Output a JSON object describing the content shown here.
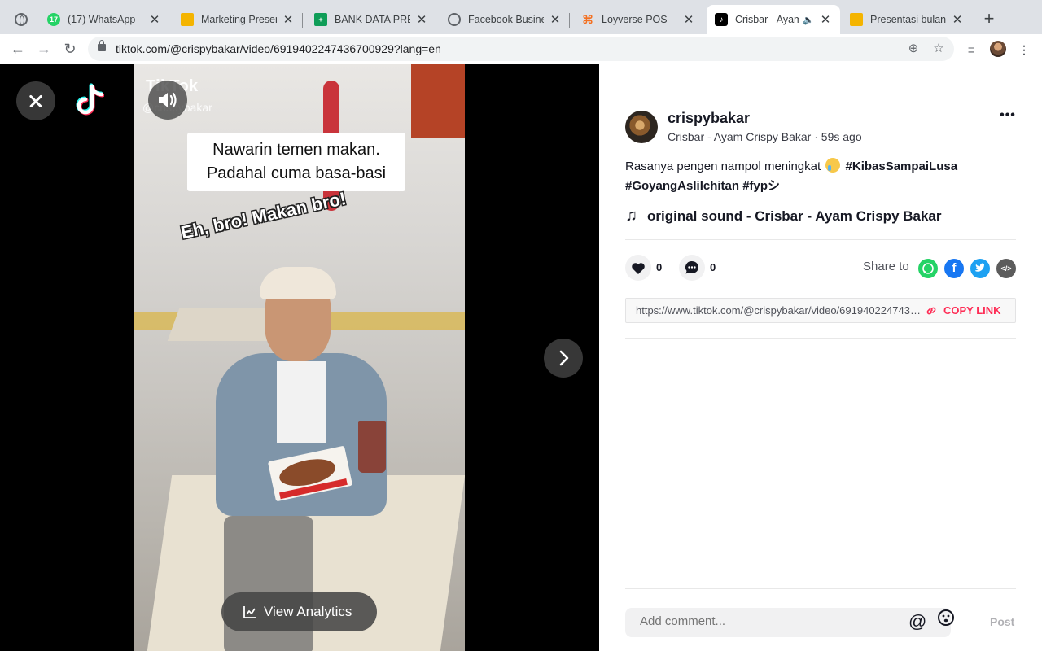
{
  "browser": {
    "tabs": [
      {
        "title": "(17) WhatsApp",
        "favicon_color": "#25d366",
        "favicon_text": "17"
      },
      {
        "title": "Marketing Presen",
        "favicon_color": "#f4b400",
        "favicon_text": ""
      },
      {
        "title": "BANK DATA PRES",
        "favicon_color": "#0f9d58",
        "favicon_text": ""
      },
      {
        "title": "Facebook Busine",
        "favicon_color": "#5f6368",
        "favicon_text": ""
      },
      {
        "title": "Loyverse POS",
        "favicon_color": "#f37021",
        "favicon_text": ""
      },
      {
        "title": "Crisbar - Ayam",
        "favicon_color": "#000000",
        "favicon_text": ""
      },
      {
        "title": "Presentasi bulan",
        "favicon_color": "#f4b400",
        "favicon_text": ""
      }
    ],
    "active_tab_index": 5,
    "url": "tiktok.com/@crispybakar/video/6919402247436700929?lang=en"
  },
  "video": {
    "watermark_logo": "TikTok",
    "watermark_user": "@crispybakar",
    "caption_line1": "Nawarin temen makan.",
    "caption_line2": "Padahal cuma basa-basi",
    "sticker_text": "Eh, bro! Makan bro!",
    "analytics_label": "View Analytics"
  },
  "post": {
    "username": "crispybakar",
    "display_name": "Crisbar - Ayam Crispy Bakar",
    "time_ago": "59s ago",
    "description_text": "Rasanya pengen nampol meningkat",
    "hashtags": [
      "#KibasSampaiLusa",
      "#GoyangAslilchitan",
      "#fypシ"
    ],
    "sound": "original sound - Crisbar - Ayam Crispy Bakar",
    "likes": "0",
    "comments": "0",
    "share_label": "Share to",
    "link": "https://www.tiktok.com/@crispybakar/video/6919402247436700929",
    "copy_link_label": "COPY LINK",
    "comment_placeholder": "Add comment...",
    "post_label": "Post"
  },
  "colors": {
    "accent": "#fe2c55",
    "whatsapp": "#25d366",
    "facebook": "#1877f2",
    "twitter": "#1da1f2",
    "embed": "#5c5c5c"
  }
}
